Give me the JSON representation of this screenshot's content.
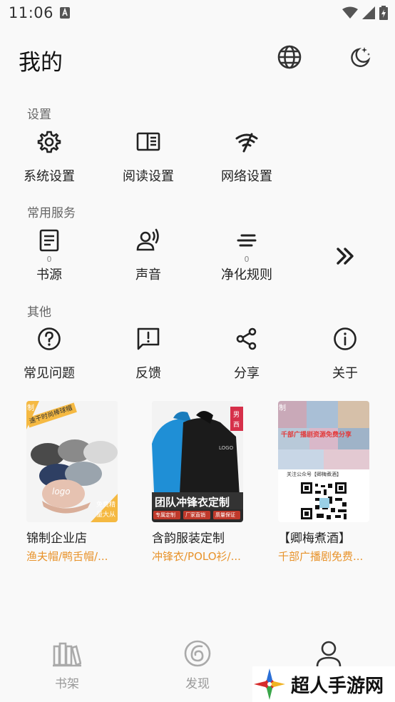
{
  "status_bar": {
    "time": "11:06"
  },
  "header": {
    "title": "我的",
    "globe_icon": "globe-icon",
    "theme_icon": "moon-stars-icon"
  },
  "sections": {
    "settings": {
      "title": "设置",
      "items": [
        {
          "label": "系统设置",
          "icon": "gear-icon"
        },
        {
          "label": "阅读设置",
          "icon": "book-layout-icon"
        },
        {
          "label": "网络设置",
          "icon": "wifi-off-icon"
        }
      ]
    },
    "services": {
      "title": "常用服务",
      "items": [
        {
          "label": "书源",
          "count": "0",
          "icon": "document-list-icon"
        },
        {
          "label": "声音",
          "icon": "speaker-voice-icon"
        },
        {
          "label": "净化规则",
          "count": "0",
          "icon": "filter-lines-icon"
        }
      ],
      "more_icon": "double-chevron-right-icon"
    },
    "other": {
      "title": "其他",
      "items": [
        {
          "label": "常见问题",
          "icon": "question-circle-icon"
        },
        {
          "label": "反馈",
          "icon": "feedback-bubble-icon"
        },
        {
          "label": "分享",
          "icon": "share-icon"
        },
        {
          "label": "关于",
          "icon": "info-circle-icon"
        }
      ]
    }
  },
  "ads": [
    {
      "title": "锦制企业店",
      "subtitle": "渔夫帽/鸭舌帽/...",
      "image_text": [
        "制",
        "速干时尚棒球帽",
        "logo",
        "免费精",
        "量大从"
      ]
    },
    {
      "title": "含韵服装定制",
      "subtitle": "冲锋衣/POLO衫/...",
      "image_text": [
        "男",
        "西",
        "LOGO",
        "团队冲锋衣定制",
        "专属定制",
        "厂家直销",
        "质量保证"
      ]
    },
    {
      "title": "【卿梅煮酒】",
      "subtitle": "千部广播剧免费...",
      "image_text": [
        "制",
        "千部广播剧资源免费分享",
        "关注公众号【卿梅煮酒】"
      ]
    }
  ],
  "bottom_nav": [
    {
      "label": "书架",
      "icon": "bookshelf-icon"
    },
    {
      "label": "发现",
      "icon": "discover-swirl-icon"
    },
    {
      "label": "我的",
      "icon": "person-icon"
    }
  ],
  "watermark": {
    "text": "超人手游网"
  },
  "colors": {
    "accent_orange": "#e8932b",
    "text_dark": "#222222",
    "nav_inactive": "#999999"
  }
}
